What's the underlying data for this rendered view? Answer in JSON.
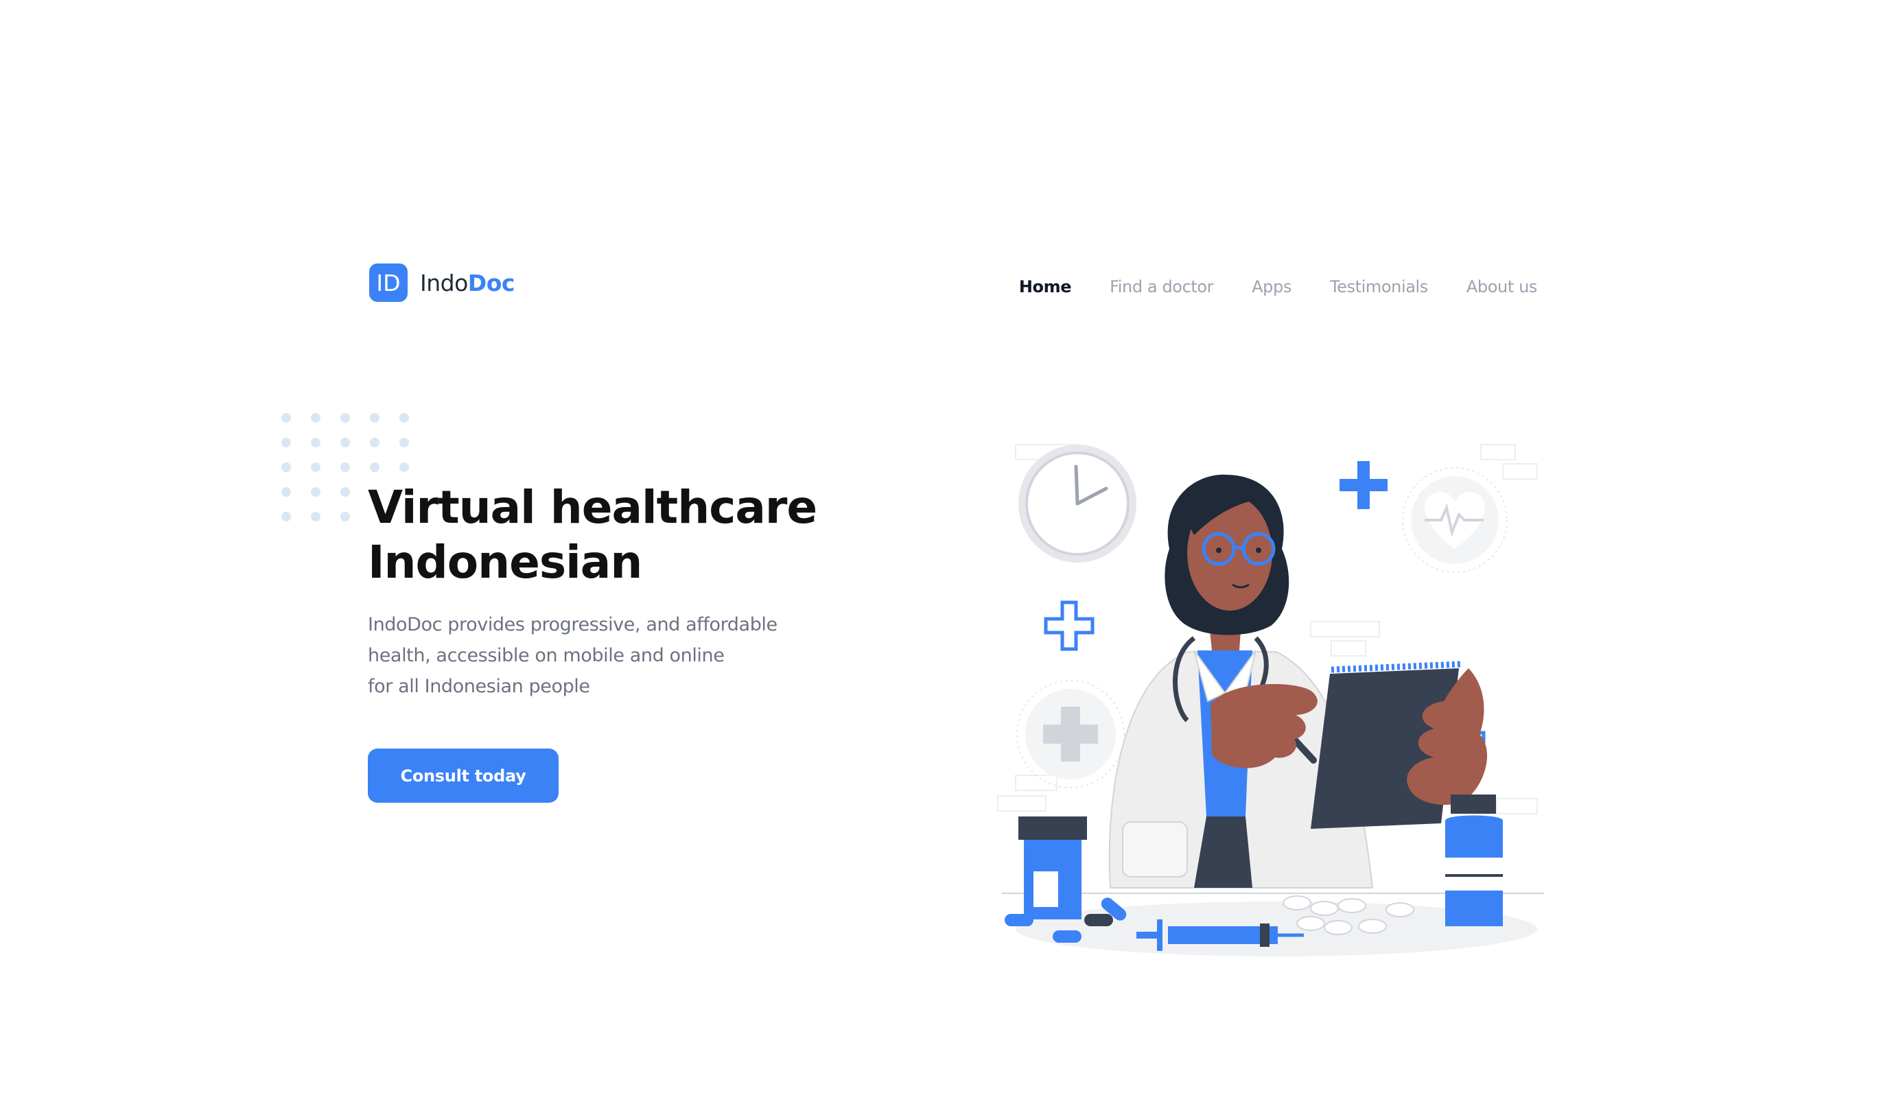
{
  "brand": {
    "mark": "ID",
    "name_part1": "Indo",
    "name_part2": "Doc"
  },
  "nav": {
    "items": [
      {
        "label": "Home",
        "active": true
      },
      {
        "label": "Find a doctor",
        "active": false
      },
      {
        "label": "Apps",
        "active": false
      },
      {
        "label": "Testimonials",
        "active": false
      },
      {
        "label": "About us",
        "active": false
      }
    ]
  },
  "hero": {
    "title": "Virtual healthcare Indonesian",
    "description": "IndoDoc provides progressive, and affordable\nhealth, accessible on mobile and online\nfor all Indonesian people",
    "cta_label": "Consult today"
  },
  "colors": {
    "accent": "#3b82f6",
    "text_dark": "#111827",
    "text_muted": "#6b7280",
    "nav_inactive": "#9ca3af",
    "dots": "#dbe6f5"
  },
  "illustration": {
    "subject": "doctor-with-clipboard",
    "icons": [
      "clock-icon",
      "heart-rate-icon",
      "medical-cross-icon",
      "medicine-bottle-icon",
      "syringe-icon",
      "pills-icon",
      "capsule-icon"
    ]
  }
}
